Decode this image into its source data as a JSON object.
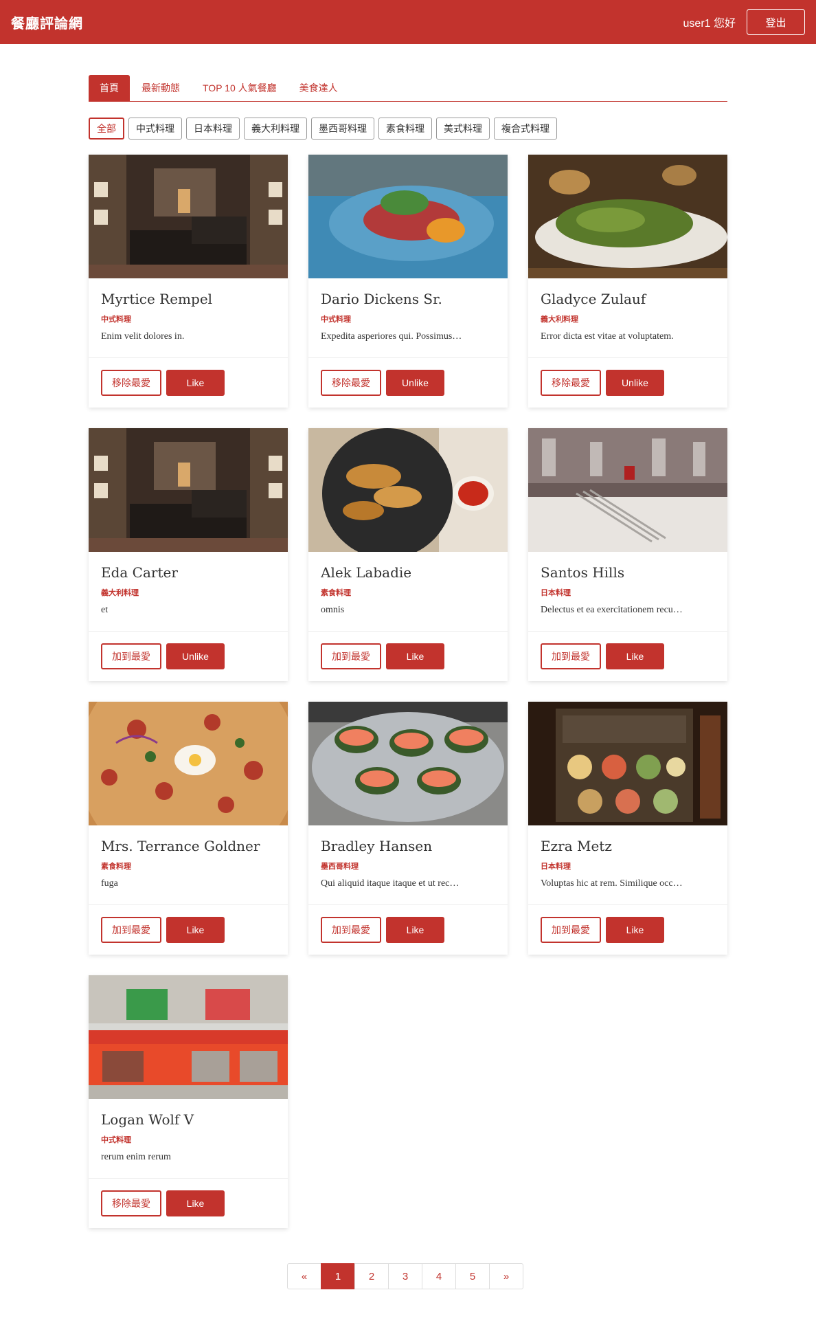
{
  "navbar": {
    "brand": "餐廳評論網",
    "greeting": "user1 您好",
    "logout_label": "登出"
  },
  "tabs": [
    "首頁",
    "最新動態",
    "TOP 10 人氣餐廳",
    "美食達人"
  ],
  "active_tab": 0,
  "filters": [
    "全部",
    "中式料理",
    "日本料理",
    "義大利料理",
    "墨西哥料理",
    "素食料理",
    "美式料理",
    "複合式料理"
  ],
  "active_filter": 0,
  "restaurants": [
    {
      "name": "Myrtice Rempel",
      "category": "中式料理",
      "description": "Enim velit dolores in.",
      "fav_label": "移除最愛",
      "like_label": "Like",
      "image": "restaurant-interior"
    },
    {
      "name": "Dario Dickens Sr.",
      "category": "中式料理",
      "description": "Expedita asperiores qui. Possimus…",
      "fav_label": "移除最愛",
      "like_label": "Unlike",
      "image": "plated-dish"
    },
    {
      "name": "Gladyce Zulauf",
      "category": "義大利料理",
      "description": "Error dicta est vitae at voluptatem.",
      "fav_label": "移除最愛",
      "like_label": "Unlike",
      "image": "green-bean-dish"
    },
    {
      "name": "Eda Carter",
      "category": "義大利料理",
      "description": "et",
      "fav_label": "加到最愛",
      "like_label": "Unlike",
      "image": "restaurant-interior"
    },
    {
      "name": "Alek Labadie",
      "category": "素食料理",
      "description": "omnis",
      "fav_label": "加到最愛",
      "like_label": "Like",
      "image": "fried-chicken"
    },
    {
      "name": "Santos Hills",
      "category": "日本料理",
      "description": "Delectus et ea exercitationem recu…",
      "fav_label": "加到最愛",
      "like_label": "Like",
      "image": "table-setting"
    },
    {
      "name": "Mrs. Terrance Goldner",
      "category": "素食料理",
      "description": "fuga",
      "fav_label": "加到最愛",
      "like_label": "Like",
      "image": "pizza"
    },
    {
      "name": "Bradley Hansen",
      "category": "墨西哥料理",
      "description": "Qui aliquid itaque itaque et ut rec…",
      "fav_label": "加到最愛",
      "like_label": "Like",
      "image": "salmon-sushi"
    },
    {
      "name": "Ezra Metz",
      "category": "日本料理",
      "description": "Voluptas hic at rem. Similique occ…",
      "fav_label": "加到最愛",
      "like_label": "Like",
      "image": "food-display"
    },
    {
      "name": "Logan Wolf V",
      "category": "中式料理",
      "description": "rerum enim rerum",
      "fav_label": "移除最愛",
      "like_label": "Like",
      "image": "storefront"
    }
  ],
  "pagination": {
    "prev": "«",
    "pages": [
      "1",
      "2",
      "3",
      "4",
      "5"
    ],
    "next": "»",
    "current": "1"
  },
  "colors": {
    "primary": "#c2332d"
  }
}
